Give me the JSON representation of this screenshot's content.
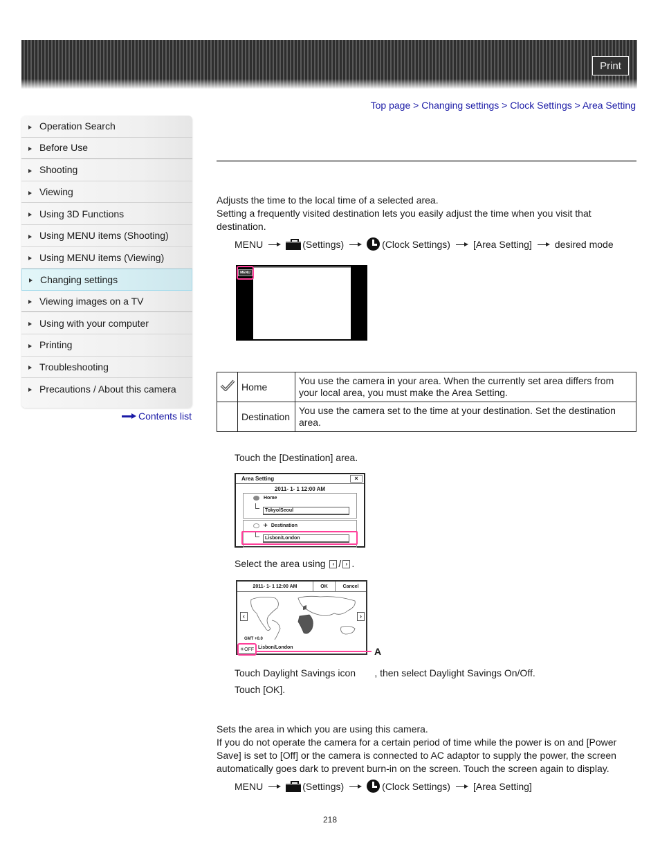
{
  "header": {
    "print_label": "Print"
  },
  "breadcrumb": {
    "items": [
      "Top page",
      "Changing settings",
      "Clock Settings",
      "Area Setting"
    ],
    "separator": ">"
  },
  "sidebar": {
    "items": [
      {
        "label": "Operation Search"
      },
      {
        "label": "Before Use"
      },
      {
        "label": "Shooting"
      },
      {
        "label": "Viewing"
      },
      {
        "label": "Using 3D Functions"
      },
      {
        "label": "Using MENU items (Shooting)"
      },
      {
        "label": "Using MENU items (Viewing)"
      },
      {
        "label": "Changing settings",
        "active": true
      },
      {
        "label": "Viewing images on a TV"
      },
      {
        "label": "Using with your computer"
      },
      {
        "label": "Printing"
      },
      {
        "label": "Troubleshooting"
      },
      {
        "label": "Precautions / About this camera"
      }
    ],
    "contents_link": "Contents list"
  },
  "main": {
    "intro_1": "Adjusts the time to the local time of a selected area.",
    "intro_2": "Setting a frequently visited destination lets you easily adjust the time when you visit that destination.",
    "path_1": {
      "menu": "MENU",
      "settings": "(Settings)",
      "clock": "(Clock Settings)",
      "area": "[Area Setting]",
      "mode": "desired mode"
    },
    "screen1": {
      "menu_label": "MENU"
    },
    "table": [
      {
        "icon": "checkmark-icon",
        "name": "Home",
        "desc": "You use the camera in your area. When the currently set area differs from your local area, you must make the Area Setting."
      },
      {
        "icon": "",
        "name": "Destination",
        "desc": "You use the camera set to the time at your destination. Set the destination area."
      }
    ],
    "step_1": "Touch the [Destination] area.",
    "area_screen": {
      "title": "Area Setting",
      "close": "×",
      "date": "2011- 1- 1  12:00 AM",
      "home_label": "Home",
      "home_city": "Tokyo/Seoul",
      "dest_label": "Destination",
      "dest_city": "Lisbon/London"
    },
    "step_2_pre": "Select the area using",
    "step_2_left": "‹",
    "step_2_sep": "/",
    "step_2_right": "›",
    "step_2_post": ".",
    "map_screen": {
      "date": "2011- 1- 1  12:00 AM",
      "ok": "OK",
      "cancel": "Cancel",
      "left": "‹",
      "right": "›",
      "gmt": "GMT  +0.0",
      "city": "Lisbon/London",
      "dst": "☀OFF",
      "callout": "A"
    },
    "step_3": "Touch Daylight Savings icon       , then select Daylight Savings On/Off.",
    "step_4": "Touch [OK].",
    "section2_1": "Sets the area in which you are using this camera.",
    "section2_2": "If you do not operate the camera for a certain period of time while the power is on and [Power Save] is set to [Off] or the camera is connected to AC adaptor to supply the power, the screen automatically goes dark to prevent burn-in on the screen. Touch the screen again to display.",
    "path_2": {
      "menu": "MENU",
      "settings": "(Settings)",
      "clock": "(Clock Settings)",
      "area": "[Area Setting]"
    }
  },
  "footer": {
    "page_number": "218"
  }
}
